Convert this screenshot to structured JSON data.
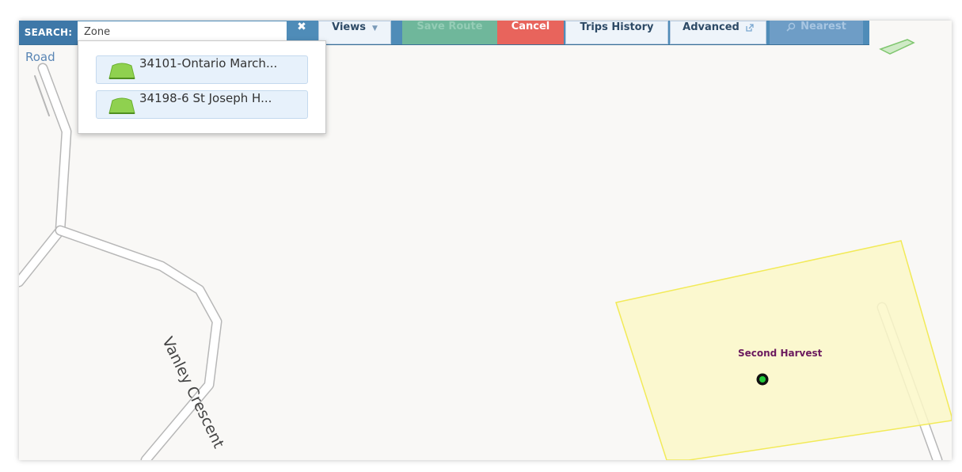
{
  "toolbar": {
    "search_label": "SEARCH:",
    "search_value": "Zone",
    "views_label": "Views",
    "save_route_label": "Save Route",
    "cancel_label": "Cancel",
    "trips_history_label": "Trips History",
    "advanced_label": "Advanced",
    "nearest_label": "Nearest"
  },
  "map_type_tab": "Road",
  "dropdown": {
    "items": [
      {
        "label": "34101-Ontario March..."
      },
      {
        "label": "34198-6 St Joseph H..."
      }
    ]
  },
  "map": {
    "street_label": "Vanley Crescent",
    "poi_label": "Second Harvest"
  },
  "colors": {
    "toolbar": "#4f8cb8",
    "cancel": "#e8645c",
    "save_route": "#6fb79b",
    "zone_fill": "#fbf8c8",
    "zone_border": "#f2ea58",
    "marker": "#22c93a"
  },
  "icons": {
    "clear": "close-icon",
    "views": "caret-down-icon",
    "advanced": "external-link-icon",
    "nearest": "search-icon",
    "zone": "zone-polygon-icon",
    "marker": "location-marker-icon"
  }
}
